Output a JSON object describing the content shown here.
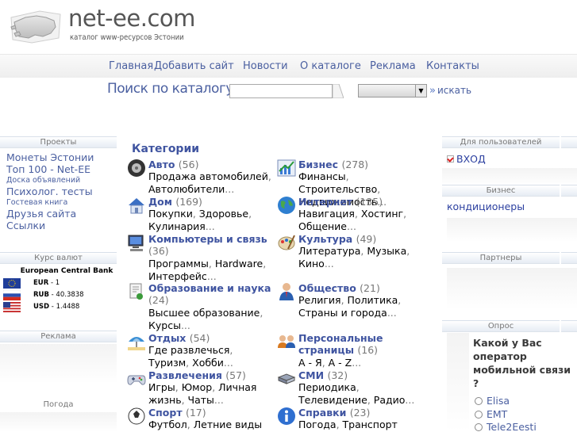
{
  "header": {
    "logo_title": "net-ee.com",
    "logo_subtitle": "каталог www-ресурсов Эстонии"
  },
  "nav": {
    "items": [
      {
        "label": "Главная"
      },
      {
        "label": "Добавить сайт"
      },
      {
        "label": "Новости"
      },
      {
        "label": "О каталоге"
      },
      {
        "label": "Реклама"
      },
      {
        "label": "Контакты"
      }
    ]
  },
  "search": {
    "label": "Поиск по каталогу:",
    "input_value": "",
    "select_value": "",
    "button_label": "искать"
  },
  "left": {
    "projects_header": "Проекты",
    "projects": [
      {
        "label": "Монеты Эстонии",
        "size": "big"
      },
      {
        "label": "Топ 100 - Net-EE",
        "size": "big"
      },
      {
        "label": "Доска объявлений",
        "size": "small"
      },
      {
        "label": "Психолог. тесты",
        "size": "big"
      },
      {
        "label": "Гостевая книга",
        "size": "small"
      },
      {
        "label": "Друзья сайта",
        "size": "big"
      },
      {
        "label": "Ссылки",
        "size": "big"
      }
    ],
    "rates_header": "Курс валют",
    "rates_bank": "European Central Bank",
    "rates": [
      {
        "code": "EUR",
        "value": "1",
        "flag": "eu"
      },
      {
        "code": "RUB",
        "value": "40.3838",
        "flag": "ru"
      },
      {
        "code": "USD",
        "value": "1.4488",
        "flag": "us"
      }
    ],
    "ads_header": "Реклама",
    "weather_header": "Погода"
  },
  "categories": {
    "title": "Категории",
    "items": [
      {
        "name": "Авто",
        "count": "(56)",
        "icon": "car-wheel-icon",
        "desc": [
          "Продажа автомобилей",
          "Автолюбители"
        ]
      },
      {
        "name": "Бизнес",
        "count": "(278)",
        "icon": "chart-icon",
        "desc": [
          "Финансы",
          "Строительство",
          "Недвижимость"
        ]
      },
      {
        "name": "Дом",
        "count": "(169)",
        "icon": "house-icon",
        "desc": [
          "Покупки",
          "Здоровье",
          "Кулинария"
        ]
      },
      {
        "name": "Интернет",
        "count": "(135)",
        "icon": "globe-icon",
        "desc": [
          "Навигация",
          "Хостинг",
          "Общение"
        ]
      },
      {
        "name": "Компьютеры и связь",
        "count": "(36)",
        "icon": "computer-icon",
        "desc": [
          "Программы",
          "Hardware",
          "Интерфейс"
        ]
      },
      {
        "name": "Культура",
        "count": "(49)",
        "icon": "palette-icon",
        "desc": [
          "Литература",
          "Музыка",
          "Кино"
        ]
      },
      {
        "name": "Образование и наука",
        "count": "(24)",
        "icon": "education-icon",
        "desc": [
          "Высшее образование",
          "Курсы"
        ]
      },
      {
        "name": "Общество",
        "count": "(21)",
        "icon": "person-icon",
        "desc": [
          "Религия",
          "Политика",
          "Страны и города"
        ]
      },
      {
        "name": "Отдых",
        "count": "(54)",
        "icon": "umbrella-icon",
        "desc": [
          "Где развлечься",
          "Туризм",
          "Хобби"
        ]
      },
      {
        "name": "Персональные страницы",
        "count": "(16)",
        "icon": "people-icon",
        "desc": [
          "А - Я",
          "A - Z"
        ]
      },
      {
        "name": "Развлечения",
        "count": "(57)",
        "icon": "gamepad-icon",
        "desc": [
          "Игры",
          "Юмор",
          "Личная жизнь",
          "Чаты"
        ]
      },
      {
        "name": "СМИ",
        "count": "(32)",
        "icon": "media-icon",
        "desc": [
          "Периодика",
          "Телевидение",
          "Радио"
        ]
      },
      {
        "name": "Спорт",
        "count": "(17)",
        "icon": "sport-icon",
        "desc": [
          "Футбол",
          "Летние виды"
        ]
      },
      {
        "name": "Справки",
        "count": "(23)",
        "icon": "info-icon",
        "desc": [
          "Погода",
          "Транспорт"
        ]
      }
    ]
  },
  "right": {
    "users_header": "Для пользователей",
    "login_label": "ВХОД",
    "business_header": "Бизнес",
    "business_link": "кондиционеры",
    "partners_header": "Партнеры",
    "poll_header": "Опрос",
    "poll_question": "Какой у Вас оператор мобильной связи ?",
    "poll_options": [
      {
        "label": "Elisa"
      },
      {
        "label": "EMT"
      },
      {
        "label": "Tele2Eesti"
      }
    ]
  },
  "colors": {
    "link": "#4a5fa0",
    "category_title": "#3f54a0",
    "box_header_text": "#777777"
  }
}
